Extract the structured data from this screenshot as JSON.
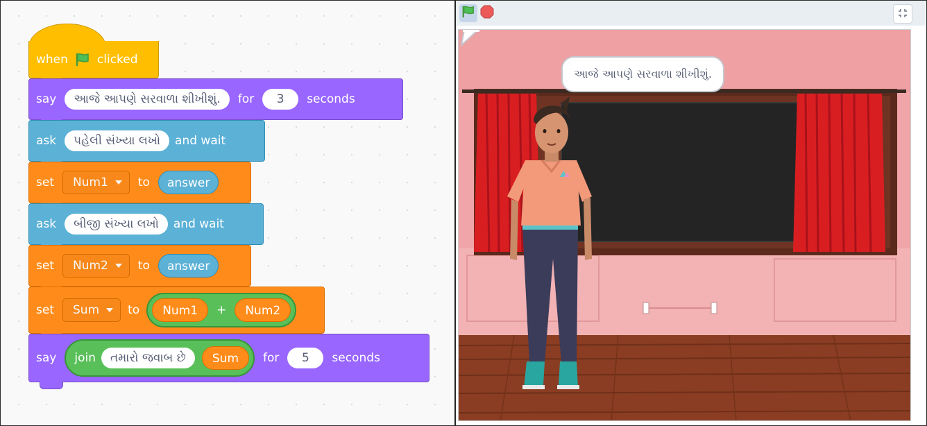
{
  "code": {
    "hat": {
      "when": "when",
      "clicked": "clicked"
    },
    "say1": {
      "keyword": "say",
      "message": "આજે આપણે સરવાળા શીખીશું.",
      "for": "for",
      "secs": "3",
      "seconds": "seconds"
    },
    "ask1": {
      "keyword": "ask",
      "question": "પહેલી સંખ્યા લખો",
      "and_wait": "and wait"
    },
    "set1": {
      "keyword": "set",
      "variable": "Num1",
      "to": "to",
      "value": "answer"
    },
    "ask2": {
      "keyword": "ask",
      "question": "બીજી સંખ્યા લખો",
      "and_wait": "and wait"
    },
    "set2": {
      "keyword": "set",
      "variable": "Num2",
      "to": "to",
      "value": "answer"
    },
    "set3": {
      "keyword": "set",
      "variable": "Sum",
      "to": "to",
      "left": "Num1",
      "op": "+",
      "right": "Num2"
    },
    "say2": {
      "keyword": "say",
      "join": "join",
      "text": "તમારો જવાબ છે",
      "var": "Sum",
      "for": "for",
      "secs": "5",
      "seconds": "seconds"
    }
  },
  "stage": {
    "speech": "આજે આપણે સરવાળા શીખીશું.",
    "controls": {
      "green_flag": "green-flag-icon",
      "stop": "stop-icon",
      "fullscreen": "fullscreen-icon"
    }
  },
  "colors": {
    "events": "#ffbf00",
    "looks": "#9966ff",
    "sensing": "#5cb1d6",
    "variables": "#ff8c1a",
    "operators": "#59c059"
  }
}
